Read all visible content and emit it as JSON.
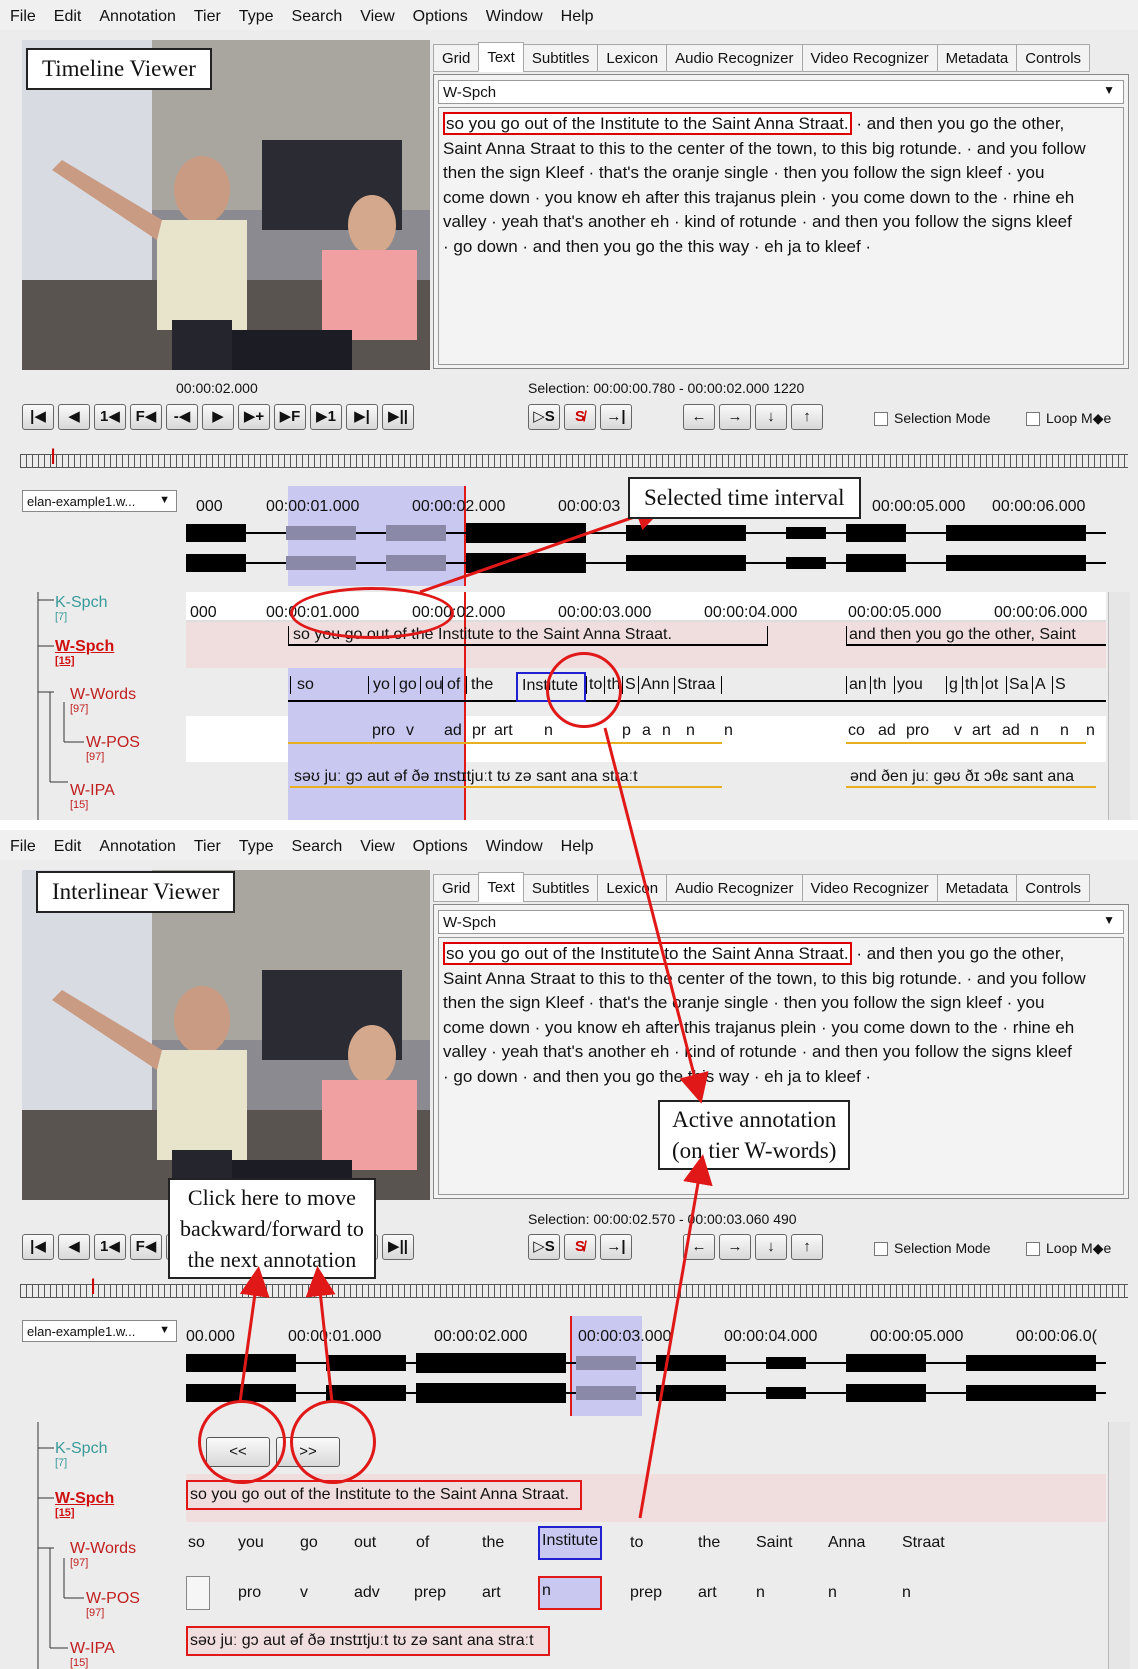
{
  "menu": [
    "File",
    "Edit",
    "Annotation",
    "Tier",
    "Type",
    "Search",
    "View",
    "Options",
    "Window",
    "Help"
  ],
  "tabs": [
    "Grid",
    "Text",
    "Subtitles",
    "Lexicon",
    "Audio Recognizer",
    "Video Recognizer",
    "Metadata",
    "Controls"
  ],
  "tier_select": "W-Spch",
  "text_panel": {
    "highlight": "so you go out of the Institute to the Saint Anna Straat.",
    "lines": [
      " · and then you go the other,",
      "Saint Anna Straat to this to the center of the town, to this big rotunde.  · and you follow",
      "then the sign Kleef  · that's the oranje single  · then you follow the sign kleef  · you",
      "come down  · you know eh after this trajanus plein  · you come down to the  · rhine eh",
      "valley  · yeah that's another eh  · kind of rotunde  · and then you follow the signs kleef",
      " · go down  · and then you go the this way  · eh ja to kleef  ·"
    ]
  },
  "top": {
    "caption": "Timeline Viewer",
    "time": "00:00:02.000",
    "selection": "Selection: 00:00:00.780 - 00:00:02.000  1220",
    "combo": "elan-example1.w...",
    "wave_ticks": [
      "000",
      "00:00:01.000",
      "00:00:02.000",
      "00:00:03",
      "00:00:05.000",
      "00:00:06.000"
    ],
    "tier_ticks": [
      "000",
      "00:00:01.000",
      "00:00:02.000",
      "00:00:03.000",
      "00:00:04.000",
      "00:00:05.000",
      "00:00:06.000"
    ],
    "callout": "Selected time interval",
    "spch_ann": [
      "so you go out of the Institute to the Saint Anna Straat.",
      "and then you go the other, Saint"
    ],
    "words": [
      "so",
      "yo",
      "go",
      "ou",
      "of",
      "the",
      "Institute",
      "to",
      "th",
      "S",
      "Ann",
      "Straa",
      "an",
      "th",
      "you",
      "g",
      "th",
      "ot",
      "Sa",
      "A",
      "S"
    ],
    "pos": [
      "pro",
      "v",
      "ad",
      "pr",
      "art",
      "n",
      "p",
      "a",
      "n",
      "n",
      "n",
      "co",
      "ad",
      "pro",
      "v",
      "art",
      "ad",
      "n",
      "n",
      "n"
    ],
    "ipa": [
      "səʊ  juː gɔ aut əf ðə ɪnstɪtjuːt tʊ zə sant ana straːt",
      "ənd ðen juː gəʊ ðɪ ɔθɛ sant ana"
    ]
  },
  "bottom": {
    "caption": "Interlinear Viewer",
    "selection": "Selection: 00:00:02.570 - 00:00:03.060  490",
    "combo": "elan-example1.w...",
    "wave_ticks": [
      "00.000",
      "00:00:01.000",
      "00:00:02.000",
      "00:00:03.000",
      "00:00:04.000",
      "00:00:05.000",
      "00:00:06.0("
    ],
    "callout_click": [
      "Click here to move",
      "backward/forward to",
      "the next annotation"
    ],
    "callout_active": [
      "Active annotation",
      "(on tier W-words)"
    ],
    "prev_label": "<<",
    "next_label": ">>",
    "spch": "so you go out of the Institute to the Saint Anna Straat.",
    "words": [
      "so",
      "you",
      "go",
      "out",
      "of",
      "the",
      "Institute",
      "to",
      "the",
      "Saint",
      "Anna",
      "Straat"
    ],
    "pos": [
      "",
      "pro",
      "v",
      "adv",
      "prep",
      "art",
      "n",
      "prep",
      "art",
      "n",
      "n",
      "n"
    ],
    "ipa": "səʊ  juː gɔ aut əf ðə ɪnstɪtjuːt tʊ zə sant ana straːt"
  },
  "tiers": [
    {
      "name": "K-Spch",
      "count": "[7]",
      "color": "#3a9a9a"
    },
    {
      "name": "W-Spch",
      "count": "[15]",
      "color": "#d01010"
    },
    {
      "name": "W-Words",
      "count": "[97]",
      "color": "#c02020"
    },
    {
      "name": "W-POS",
      "count": "[97]",
      "color": "#c02020"
    },
    {
      "name": "W-IPA",
      "count": "[15]",
      "color": "#c02020"
    }
  ],
  "controls": {
    "selection_mode": "Selection Mode",
    "loop_mode": "Loop M◆e"
  },
  "colors": {
    "accent": "#e01818",
    "selection": "#c8c8f0",
    "active": "#2020d0"
  }
}
